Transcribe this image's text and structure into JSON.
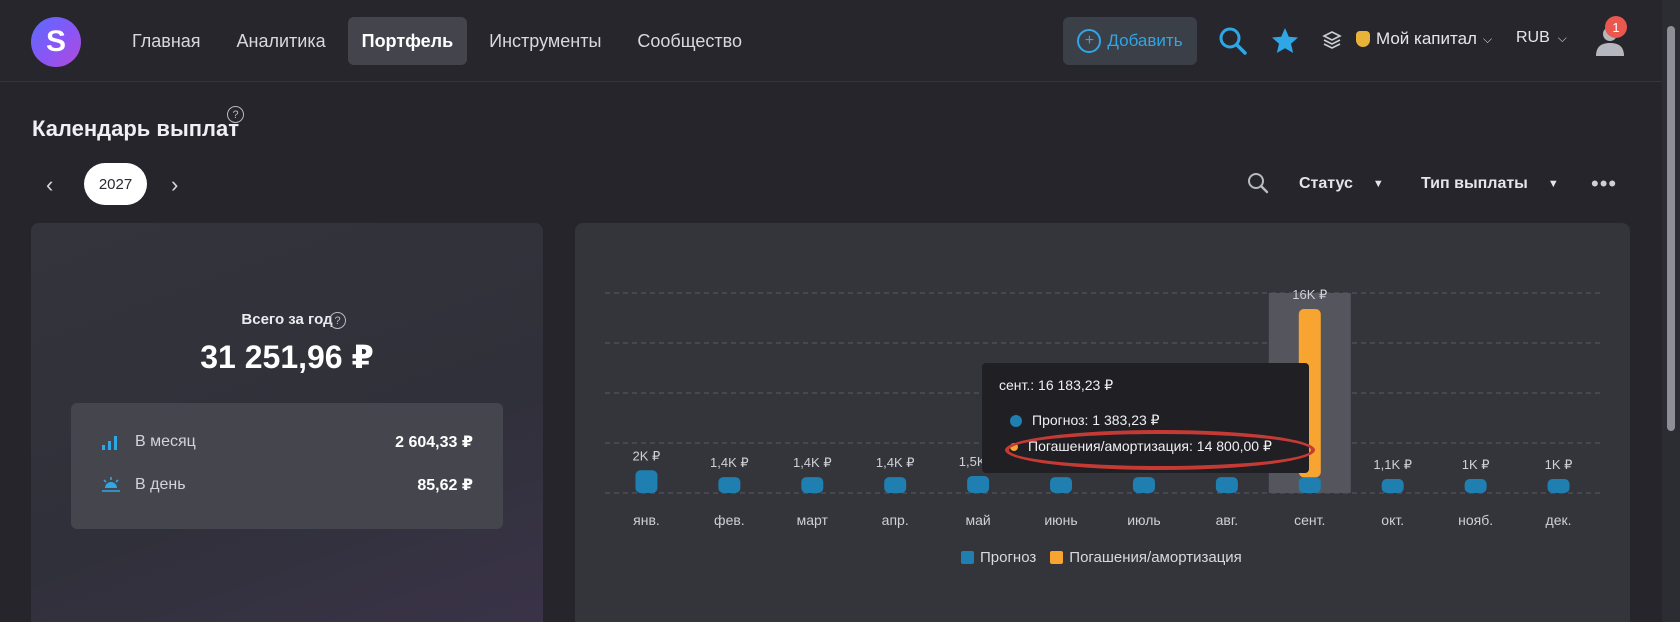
{
  "app": {
    "logo_letter": "S"
  },
  "nav": {
    "items": [
      {
        "label": "Главная"
      },
      {
        "label": "Аналитика"
      },
      {
        "label": "Портфель",
        "active": true
      },
      {
        "label": "Инструменты"
      },
      {
        "label": "Сообщество"
      }
    ]
  },
  "header": {
    "add_label": "Добавить",
    "capital_label": "Мой капитал",
    "currency": "RUB",
    "notifications_count": "1",
    "icons": [
      "search-icon",
      "star-icon",
      "layers-icon",
      "coin-icon",
      "user-icon"
    ]
  },
  "page": {
    "title": "Календарь выплат",
    "help": "?"
  },
  "year_selector": {
    "year": "2027"
  },
  "filters": {
    "status_label": "Статус",
    "type_label": "Тип выплаты",
    "more": "•••"
  },
  "summary": {
    "total_label": "Всего за год",
    "total_value": "31 251,96 ₽",
    "per_month_label": "В месяц",
    "per_month_value": "2 604,33 ₽",
    "per_day_label": "В день",
    "per_day_value": "85,62 ₽"
  },
  "colors": {
    "forecast": "#1f7fb0",
    "amortization": "#f7a530",
    "accent": "#2fa6e6"
  },
  "tooltip": {
    "header": "сент.: 16 183,23 ₽",
    "forecast_line": "Прогноз: 1 383,23 ₽",
    "amort_line": "Погашения/амортизация: 14 800,00 ₽"
  },
  "chart_data": {
    "type": "bar",
    "stacked": true,
    "categories": [
      "янв.",
      "фев.",
      "март",
      "апр.",
      "май",
      "июнь",
      "июль",
      "авг.",
      "сент.",
      "окт.",
      "нояб.",
      "дек."
    ],
    "bar_labels": [
      "2K ₽",
      "1,4K ₽",
      "1,4K ₽",
      "1,4K ₽",
      "1,5K ₽",
      "",
      "",
      "",
      "16K ₽",
      "1,1K ₽",
      "1K ₽",
      "1K ₽"
    ],
    "series": [
      {
        "name": "Прогноз",
        "color": "#1f7fb0",
        "values": [
          2000,
          1400,
          1400,
          1400,
          1500,
          1400,
          1400,
          1400,
          1383.23,
          1100,
          1000,
          1000
        ]
      },
      {
        "name": "Погашения/амортизация",
        "color": "#f7a530",
        "values": [
          0,
          0,
          0,
          0,
          0,
          0,
          0,
          0,
          14800,
          0,
          0,
          0
        ]
      }
    ],
    "highlighted_category": "сент.",
    "legend_position": "bottom",
    "grid": true
  }
}
